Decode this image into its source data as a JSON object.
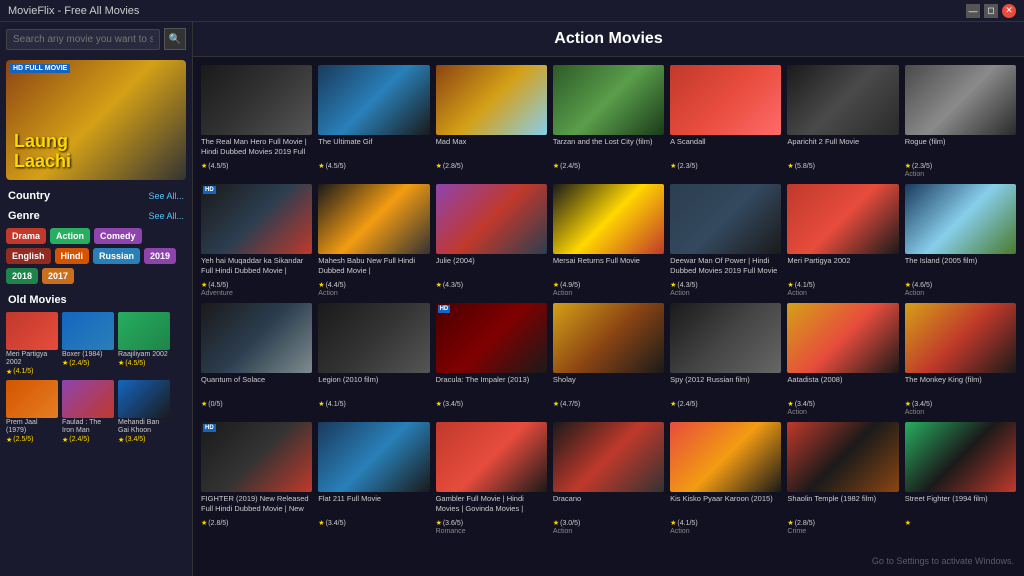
{
  "titleBar": {
    "text": "MovieFlix - Free All Movies"
  },
  "sidebar": {
    "search": {
      "placeholder": "Search any movie you want to search",
      "value": ""
    },
    "featured": {
      "badge": "HD FULL MOVIE",
      "title": "Laung\nLaachi"
    },
    "country": {
      "label": "Country",
      "seeAll": "See All..."
    },
    "genre": {
      "label": "Genre",
      "seeAll": "See All..."
    },
    "genreButtons": [
      {
        "label": "Drama",
        "color": "btn-red"
      },
      {
        "label": "Action",
        "color": "btn-green"
      },
      {
        "label": "Comedy",
        "color": "btn-purple"
      },
      {
        "label": "English",
        "color": "btn-darkred"
      },
      {
        "label": "Hindi",
        "color": "btn-orange"
      },
      {
        "label": "Russian",
        "color": "btn-blue"
      },
      {
        "label": "2019",
        "color": "btn-purple"
      },
      {
        "label": "2018",
        "color": "btn-darkgreen"
      },
      {
        "label": "2017",
        "color": "btn-darkorange"
      }
    ],
    "oldMovies": {
      "label": "Old Movies",
      "items": [
        {
          "title": "Meri Partigya 2002",
          "rating": "(4.1/5)",
          "thumb": "thumb-old1"
        },
        {
          "title": "Boxer (1984)",
          "rating": "(2.4/5)",
          "thumb": "thumb-old2"
        },
        {
          "title": "Raajiliyam 2002",
          "rating": "(4.5/5)",
          "thumb": "thumb-old3"
        },
        {
          "title": "Prem Jaal (1979)",
          "rating": "(2.5/5)",
          "thumb": "thumb-old4"
        },
        {
          "title": "Faulad : The Iron Man",
          "rating": "(2.4/5)",
          "thumb": "thumb-old5"
        },
        {
          "title": "Mehandi Ban Gai Khoon",
          "rating": "(3.4/5)",
          "thumb": "thumb-old6"
        }
      ]
    }
  },
  "main": {
    "title": "Action Movies",
    "movies": [
      {
        "title": "The Real Man Hero Full Movie | Hindi Dubbed Movies 2019 Full",
        "rating": "(4.5/5)",
        "genre": "",
        "thumb": "thumb-real-man",
        "badge": ""
      },
      {
        "title": "The Ultimate Gif",
        "rating": "(4.5/5)",
        "genre": "",
        "thumb": "thumb-ultimategif",
        "badge": ""
      },
      {
        "title": "Mad Max",
        "rating": "(2.8/5)",
        "genre": "",
        "thumb": "thumb-madmax",
        "badge": ""
      },
      {
        "title": "Tarzan and the Lost City (film)",
        "rating": "(2.4/5)",
        "genre": "",
        "thumb": "thumb-tarzan",
        "badge": ""
      },
      {
        "title": "A Scandall",
        "rating": "(2.3/5)",
        "genre": "",
        "thumb": "thumb-scandal",
        "badge": ""
      },
      {
        "title": "Aparichit 2 Full Movie",
        "rating": "(5.8/5)",
        "genre": "",
        "thumb": "thumb-aparichit",
        "badge": ""
      },
      {
        "title": "Rogue (film)",
        "rating": "(2.3/5)",
        "genre": "Action",
        "thumb": "thumb-rogue",
        "badge": ""
      },
      {
        "title": "Yeh hai Muqaddar ka Sikandar Full Hindi Dubbed Movie |",
        "rating": "(4.5/5)",
        "genre": "Adventure",
        "thumb": "thumb-yeh",
        "badge": "HD"
      },
      {
        "title": "Mahesh Babu New Full Hindi Dubbed Movie |",
        "rating": "(4.4/5)",
        "genre": "Action",
        "thumb": "thumb-mahesh",
        "badge": ""
      },
      {
        "title": "Julie (2004)",
        "rating": "(4.3/5)",
        "genre": "",
        "thumb": "thumb-julie",
        "badge": ""
      },
      {
        "title": "Mersai Returns Full Movie",
        "rating": "(4.9/5)",
        "genre": "Action",
        "thumb": "thumb-mersai",
        "badge": ""
      },
      {
        "title": "Deewar Man Of Power | Hindi Dubbed Movies 2019 Full Movie",
        "rating": "(4.3/5)",
        "genre": "Action",
        "thumb": "thumb-deewar",
        "badge": ""
      },
      {
        "title": "Meri Partigya 2002",
        "rating": "(4.1/5)",
        "genre": "Action",
        "thumb": "thumb-meri",
        "badge": ""
      },
      {
        "title": "The Island (2005 film)",
        "rating": "(4.6/5)",
        "genre": "Action",
        "thumb": "thumb-island",
        "badge": ""
      },
      {
        "title": "Quantum of Solace",
        "rating": "(0/5)",
        "genre": "",
        "thumb": "thumb-quantum",
        "badge": ""
      },
      {
        "title": "Legion (2010 film)",
        "rating": "(4.1/5)",
        "genre": "",
        "thumb": "thumb-legion",
        "badge": ""
      },
      {
        "title": "Dracula: The Impaler (2013)",
        "rating": "(3.4/5)",
        "genre": "",
        "thumb": "thumb-dracula",
        "badge": "HD"
      },
      {
        "title": "Sholay",
        "rating": "(4.7/5)",
        "genre": "",
        "thumb": "thumb-sholay",
        "badge": ""
      },
      {
        "title": "Spy (2012 Russian film)",
        "rating": "(2.4/5)",
        "genre": "",
        "thumb": "thumb-spy",
        "badge": ""
      },
      {
        "title": "Aatadista (2008)",
        "rating": "(3.4/5)",
        "genre": "Action",
        "thumb": "thumb-aatadista",
        "badge": ""
      },
      {
        "title": "The Monkey King (film)",
        "rating": "(3.4/5)",
        "genre": "Action",
        "thumb": "thumb-monkey",
        "badge": ""
      },
      {
        "title": "FIGHTER (2019) New Released Full Hindi Dubbed Movie | New",
        "rating": "(2.8/5)",
        "genre": "",
        "thumb": "thumb-fighter",
        "badge": "HD"
      },
      {
        "title": "Flat 211 Full Movie",
        "rating": "(3.4/5)",
        "genre": "",
        "thumb": "thumb-flat211",
        "badge": ""
      },
      {
        "title": "Gambler Full Movie | Hindi Movies | Govinda Movies |",
        "rating": "(3.6/5)",
        "genre": "Romance",
        "thumb": "thumb-gambler",
        "badge": ""
      },
      {
        "title": "Dracano",
        "rating": "(3.0/5)",
        "genre": "Action",
        "thumb": "thumb-dracano",
        "badge": ""
      },
      {
        "title": "Kis Kisko Pyaar Karoon (2015)",
        "rating": "(4.1/5)",
        "genre": "Action",
        "thumb": "thumb-kisko",
        "badge": ""
      },
      {
        "title": "Shaolin Temple (1982 film)",
        "rating": "(2.8/5)",
        "genre": "Crime",
        "thumb": "thumb-shaolin",
        "badge": ""
      },
      {
        "title": "Street Fighter (1994 film)",
        "rating": "",
        "genre": "",
        "thumb": "thumb-street",
        "badge": ""
      }
    ]
  },
  "windows": {
    "watermark": "Go to Settings to activate Windows."
  }
}
